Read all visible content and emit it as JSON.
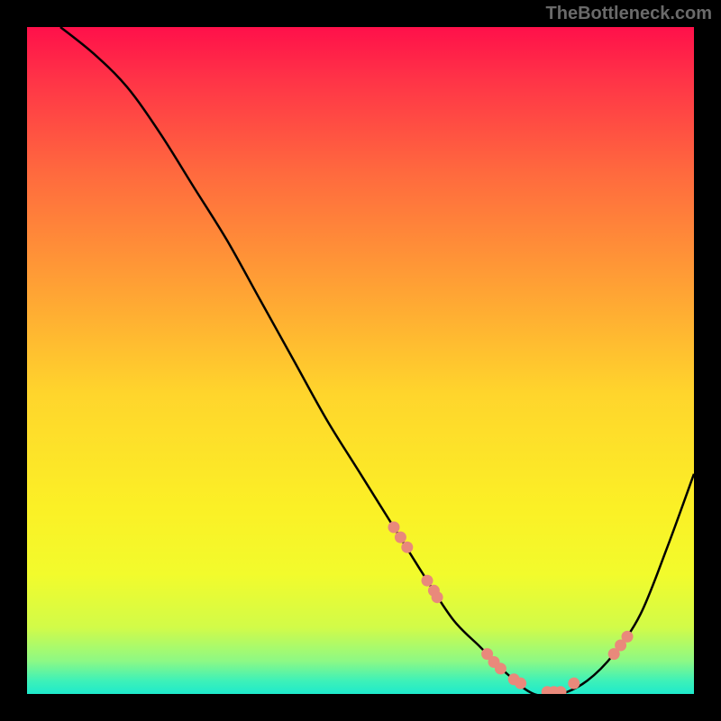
{
  "watermark": "TheBottleneck.com",
  "chart_data": {
    "type": "line",
    "title": "",
    "xlabel": "",
    "ylabel": "",
    "xlim": [
      0,
      100
    ],
    "ylim": [
      0,
      100
    ],
    "series": [
      {
        "name": "bottleneck-curve",
        "x": [
          5,
          10,
          15,
          20,
          25,
          30,
          35,
          40,
          45,
          50,
          55,
          60,
          64,
          68,
          72,
          76,
          80,
          84,
          88,
          92,
          96,
          100
        ],
        "y": [
          100,
          96,
          91,
          84,
          76,
          68,
          59,
          50,
          41,
          33,
          25,
          17,
          11,
          7,
          3,
          0,
          0,
          2,
          6,
          12,
          22,
          33
        ]
      }
    ],
    "markers": {
      "name": "highlight-points",
      "x": [
        55,
        56,
        57,
        60,
        61,
        61.5,
        69,
        70,
        71,
        73,
        74,
        78,
        79,
        80,
        82,
        88,
        89,
        90
      ],
      "y": [
        25,
        23.5,
        22,
        17,
        15.5,
        14.5,
        6,
        4.8,
        3.8,
        2.2,
        1.6,
        0.3,
        0.3,
        0.3,
        1.6,
        6,
        7.3,
        8.6
      ]
    },
    "gradient_stops": [
      {
        "pct": 0,
        "color": "#ff104a"
      },
      {
        "pct": 8,
        "color": "#ff3447"
      },
      {
        "pct": 22,
        "color": "#ff6a3e"
      },
      {
        "pct": 38,
        "color": "#ff9e35"
      },
      {
        "pct": 55,
        "color": "#ffd52c"
      },
      {
        "pct": 72,
        "color": "#fbf026"
      },
      {
        "pct": 82,
        "color": "#f2fb2c"
      },
      {
        "pct": 90,
        "color": "#d2fb48"
      },
      {
        "pct": 95,
        "color": "#8ef984"
      },
      {
        "pct": 98,
        "color": "#3ef1b8"
      },
      {
        "pct": 100,
        "color": "#1eeacc"
      }
    ],
    "marker_color": "#e9897b",
    "curve_color": "#000000"
  }
}
